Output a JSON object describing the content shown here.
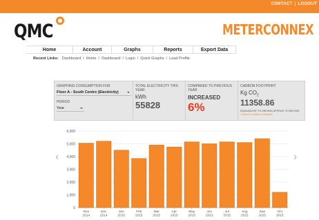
{
  "header": {
    "links": [
      "CONTACT",
      "|",
      "LOGOUT"
    ],
    "logo": "QMC",
    "brand": "METERCONNEX"
  },
  "nav": {
    "items": [
      "Home",
      "Account",
      "Graphs",
      "Reports",
      "Export Data"
    ]
  },
  "recent": {
    "title": "Recent Links:",
    "links": [
      "Dashboard",
      "Home",
      "Dashboard",
      "Login",
      "Quick Graphs",
      "Load Profile"
    ],
    "separator": "/"
  },
  "panel": {
    "consumption_label": "GRAPHING CONSUMPTION FOR",
    "consumption_value": "Floor A - South Centre (Electricity)",
    "period_label": "PERIOD",
    "period_value": "Year",
    "total_label": "TOTAL ELECTRICITY THIS YEAR",
    "total_unit": "kWh",
    "total_value": "55828",
    "compare_label": "COMPARED TO PREVIOUS YEAR",
    "compare_status": "INCREASED",
    "compare_pct": "6%",
    "carbon_label": "CARBON FOOTPRINT",
    "carbon_unit_prefix": "Kg CO",
    "carbon_unit_sub": "2",
    "carbon_value": "11358.86",
    "equiv_text": "EQUIVALENT TO DRIVING APPROX 70,995 KMS",
    "equiv_link": "* what is a carbon footprint?"
  },
  "colors": {
    "accent": "#f5892a",
    "bar": "#f5892a",
    "bar_stroke": "#c9661a",
    "increase": "#f03a1e"
  },
  "chart_data": {
    "type": "bar",
    "categories": [
      [
        "Nov",
        "2014"
      ],
      [
        "Dec",
        "2014"
      ],
      [
        "Jan",
        "2015"
      ],
      [
        "Feb",
        "2015"
      ],
      [
        "Mar",
        "2015"
      ],
      [
        "Apr",
        "2015"
      ],
      [
        "May",
        "2015"
      ],
      [
        "Jun",
        "2015"
      ],
      [
        "Jul",
        "2015"
      ],
      [
        "Aug",
        "2015"
      ],
      [
        "Sep",
        "2015"
      ],
      [
        "Oct",
        "2015"
      ]
    ],
    "values": [
      5050,
      5200,
      4500,
      3850,
      4900,
      4750,
      5150,
      5000,
      5150,
      5100,
      5400,
      1200
    ],
    "ylim": [
      0,
      6000
    ],
    "yticks": [
      0,
      1000,
      2000,
      3000,
      4000,
      5000,
      6000
    ],
    "ytick_labels": [
      "0",
      "1,000",
      "2,000",
      "3,000",
      "4,000",
      "5,000",
      "6,000"
    ]
  },
  "icons": {
    "prev": "chevron-left-icon",
    "next": "chevron-right-icon"
  },
  "arrows": {
    "prev": "‹",
    "next": "›"
  }
}
